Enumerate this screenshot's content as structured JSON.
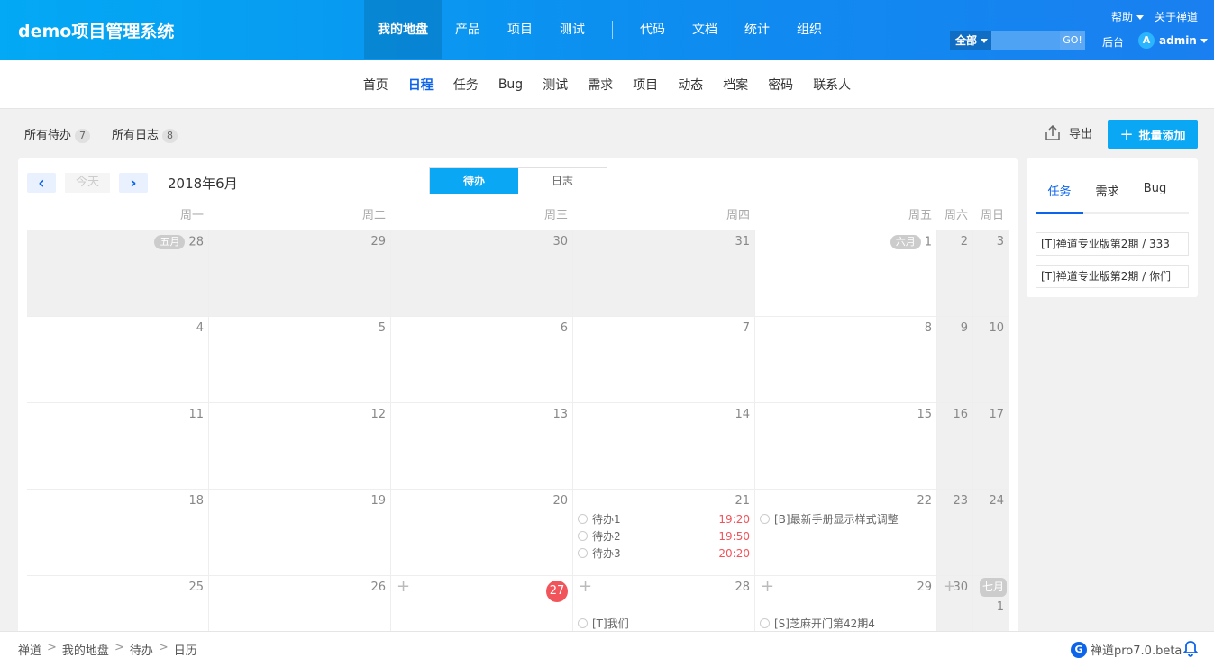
{
  "header": {
    "brand": "demo项目管理系统",
    "nav": [
      "我的地盘",
      "产品",
      "项目",
      "测试",
      "代码",
      "文档",
      "统计",
      "组织"
    ],
    "help": "帮助",
    "about": "关于禅道",
    "search_scope": "全部",
    "search_go": "GO!",
    "backend": "后台",
    "user_initial": "A",
    "user": "admin"
  },
  "subnav": [
    "首页",
    "日程",
    "任务",
    "Bug",
    "测试",
    "需求",
    "项目",
    "动态",
    "档案",
    "密码",
    "联系人"
  ],
  "filters": {
    "todo_label": "所有待办",
    "todo_count": "7",
    "log_label": "所有日志",
    "log_count": "8"
  },
  "toolbar": {
    "export": "导出",
    "batch_add": "批量添加"
  },
  "calendar": {
    "today": "今天",
    "month": "2018年6月",
    "view_tabs": [
      "待办",
      "日志"
    ],
    "weekdays": [
      "周一",
      "周二",
      "周三",
      "周四",
      "周五",
      "周六",
      "周日"
    ],
    "month_tags": {
      "may": "五月",
      "june": "六月",
      "july": "七月"
    },
    "weeks": [
      [
        "28",
        "29",
        "30",
        "31",
        "1",
        "2",
        "3"
      ],
      [
        "4",
        "5",
        "6",
        "7",
        "8",
        "9",
        "10"
      ],
      [
        "11",
        "12",
        "13",
        "14",
        "15",
        "16",
        "17"
      ],
      [
        "18",
        "19",
        "20",
        "21",
        "22",
        "23",
        "24"
      ],
      [
        "25",
        "26",
        "27",
        "28",
        "29",
        "30",
        "1"
      ]
    ],
    "events": {
      "thu21": [
        {
          "title": "待办1",
          "time": "19:20"
        },
        {
          "title": "待办2",
          "time": "19:50"
        },
        {
          "title": "待办3",
          "time": "20:20"
        }
      ],
      "fri22": [
        {
          "title": "[B]最新手册显示样式调整",
          "time": ""
        }
      ],
      "thu28": [
        {
          "title": "[T]我们",
          "time": ""
        }
      ],
      "fri29": [
        {
          "title": "[S]芝麻开门第42期4",
          "time": ""
        }
      ]
    }
  },
  "side": {
    "tabs": [
      "任务",
      "需求",
      "Bug"
    ],
    "items": [
      "[T]禅道专业版第2期 / 333",
      "[T]禅道专业版第2期 / 你们"
    ]
  },
  "footer": {
    "crumbs": [
      "禅道",
      "我的地盘",
      "待办",
      "日历"
    ],
    "version": "禅道pro7.0.beta"
  },
  "colors": {
    "brand": "#0aa7f5",
    "accent": "#0c64eb",
    "today": "#f2545b"
  }
}
